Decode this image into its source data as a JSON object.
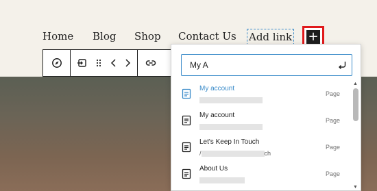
{
  "nav": {
    "items": [
      "Home",
      "Blog",
      "Shop",
      "Contact Us"
    ],
    "add_link": "Add link"
  },
  "toolbar": {
    "icons": [
      "compass-icon",
      "submenu-icon",
      "drag-handle-icon",
      "move-left-icon",
      "move-right-icon",
      "link-icon"
    ]
  },
  "search": {
    "value": "My A"
  },
  "results": [
    {
      "title": "My account",
      "url_suffix": "",
      "type": "Page",
      "active": true
    },
    {
      "title": "My account",
      "url_suffix": "",
      "type": "Page",
      "active": false
    },
    {
      "title": "Let's Keep In Touch",
      "url_prefix": "/",
      "url_suffix": "ch",
      "type": "Page",
      "active": false
    },
    {
      "title": "About Us",
      "url_suffix": "",
      "type": "Page",
      "active": false
    }
  ],
  "colors": {
    "accent": "#3a8bc9",
    "highlight_border": "#e0191b",
    "dark": "#1e1e1e"
  }
}
